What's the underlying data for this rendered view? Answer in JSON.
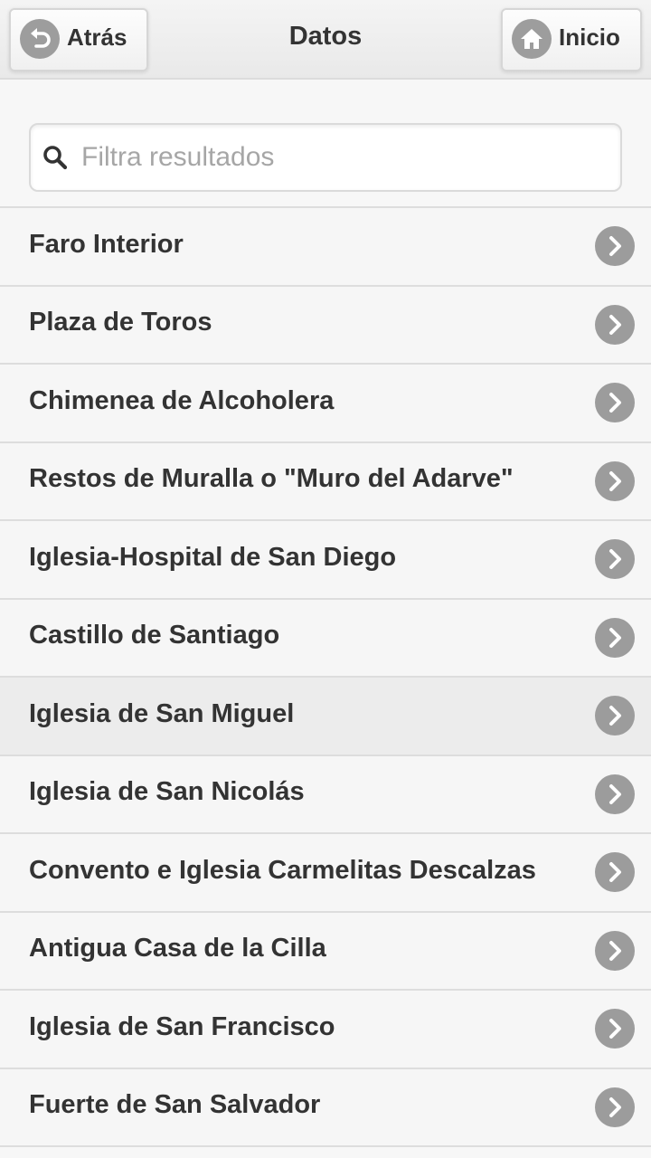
{
  "header": {
    "title": "Datos",
    "back_label": "Atrás",
    "home_label": "Inicio"
  },
  "search": {
    "placeholder": "Filtra resultados",
    "value": ""
  },
  "icons": {
    "back": "back-arrow-icon",
    "home": "home-icon",
    "search": "search-icon",
    "row": "chevron-right-icon"
  },
  "colors": {
    "header_bg": "#ececec",
    "row_bg": "#f6f6f6",
    "row_active_bg": "#ececec",
    "icon_bg": "#9c9c9c",
    "text": "#333333",
    "placeholder": "#a6a6a6"
  },
  "list": {
    "active_index": 6,
    "items": [
      "Faro Interior",
      "Plaza de Toros",
      "Chimenea de Alcoholera",
      "Restos de Muralla o \"Muro del Adarve\"",
      "Iglesia-Hospital de San Diego",
      "Castillo de Santiago",
      "Iglesia de San Miguel",
      "Iglesia de San Nicolás",
      "Convento e Iglesia Carmelitas Descalzas",
      "Antigua Casa de la Cilla",
      "Iglesia de San Francisco",
      "Fuerte de San Salvador"
    ]
  }
}
